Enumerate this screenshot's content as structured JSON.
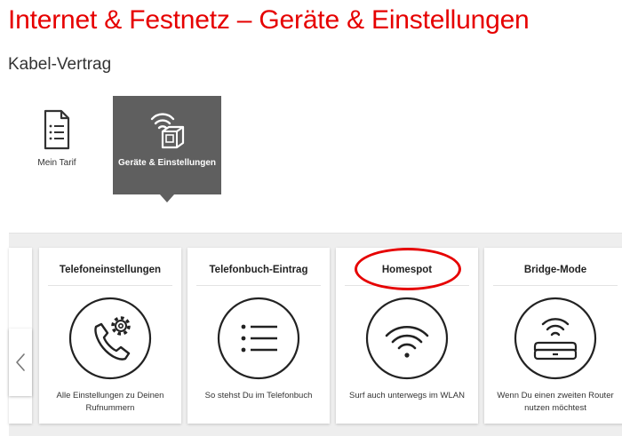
{
  "header": {
    "title": "Internet & Festnetz – Geräte & Einstellungen",
    "subtitle": "Kabel-Vertrag"
  },
  "tabs": [
    {
      "label": "Mein Tarif",
      "icon": "document-list-icon",
      "active": false
    },
    {
      "label": "Geräte & Einstellungen",
      "icon": "wifi-router-icon",
      "active": true
    }
  ],
  "cards": [
    {
      "title": "Telefoneinstellungen",
      "icon": "phone-settings-icon",
      "description": "Alle Einstellungen zu Deinen Rufnummern"
    },
    {
      "title": "Telefonbuch-Eintrag",
      "icon": "list-icon",
      "description": "So stehst Du im Telefonbuch"
    },
    {
      "title": "Homespot",
      "icon": "wifi-icon",
      "description": "Surf auch unterwegs im WLAN"
    },
    {
      "title": "Bridge-Mode",
      "icon": "router-icon",
      "description": "Wenn Du einen zweiten Router nutzen möchtest"
    }
  ],
  "carousel": {
    "prev_icon": "chevron-left-icon"
  },
  "colors": {
    "brand": "#e60000",
    "active_tab": "#5f5f5f",
    "carousel_bg": "#eeeeee"
  }
}
